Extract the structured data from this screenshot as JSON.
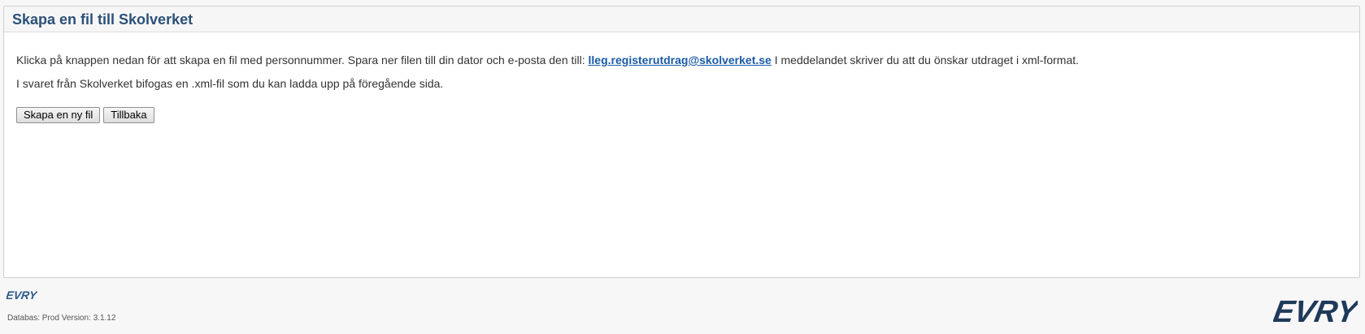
{
  "panel": {
    "title": "Skapa en fil till Skolverket",
    "instruction_before_link": "Klicka på knappen nedan för att skapa en fil med personnummer. Spara ner filen till din dator och e-posta den till: ",
    "email": "lleg.registerutdrag@skolverket.se",
    "instruction_after_link": " I meddelandet skriver du att du önskar utdraget i xml-format.",
    "response_text": "I svaret från Skolverket bifogas en .xml-fil som du kan ladda upp på föregående sida.",
    "create_button_label": "Skapa en ny fil",
    "back_button_label": "Tillbaka"
  },
  "footer": {
    "small_logo_text": "EVRY",
    "version_text": "Databas: Prod Version: 3.1.12",
    "big_logo_text": "EVRY"
  },
  "colors": {
    "title": "#2b5178",
    "link": "#1a5aa6",
    "logo_small": "#2b5a8c",
    "logo_big": "#1e3a5a"
  }
}
